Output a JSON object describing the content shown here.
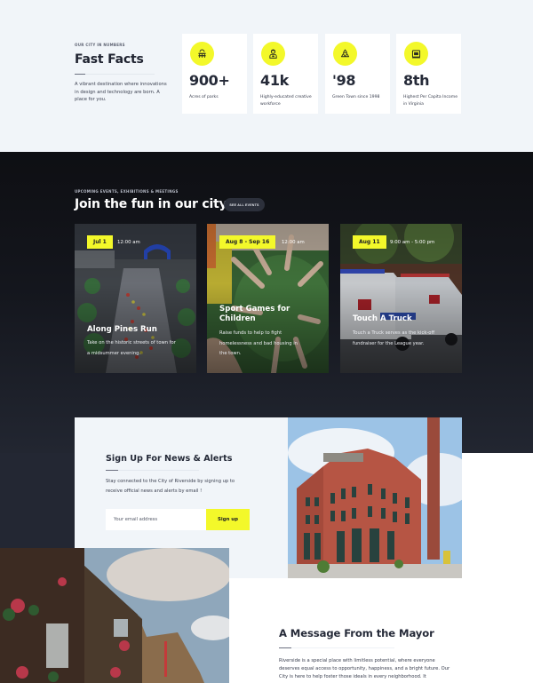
{
  "facts": {
    "eyebrow": "OUR CITY IN NUMBERS",
    "title": "Fast Facts",
    "description": "A vibrant destination where innovations in design and technology are born. A place for you.",
    "cards": [
      {
        "icon": "park-bench-icon",
        "value": "900+",
        "label": "Acres of parks"
      },
      {
        "icon": "worker-icon",
        "value": "41k",
        "label": "Highly-educated creative workforce"
      },
      {
        "icon": "recycle-icon",
        "value": "'98",
        "label": "Green Town since 1998"
      },
      {
        "icon": "money-icon",
        "value": "8th",
        "label": "Highest Per Capita Income in Virginia"
      }
    ]
  },
  "events": {
    "eyebrow": "UPCOMING EVENTS, EXHIBITIONS & MEETINGS",
    "title": "Join the fun in our city!",
    "see_all_label": "SEE ALL EVENTS",
    "items": [
      {
        "date": "Jul 1",
        "time": "12:00 am",
        "title": "Along Pines Run",
        "description": "Take on the historic streets of town for a midsummer evening."
      },
      {
        "date": "Aug 8 - Sep 16",
        "time": "12:00 am",
        "title": "Sport Games for Children",
        "description": "Raise funds to help to fight homelessness and bad housing in the town."
      },
      {
        "date": "Aug 11",
        "time": "9:00 am - 5:00 pm",
        "title": "Touch A Truck",
        "description": "Touch a Truck serves as the kick-off fundraiser for the League year."
      }
    ]
  },
  "signup": {
    "title": "Sign Up For News & Alerts",
    "description": "Stay connected to the City of Riverside by signing up to receive official news and alerts by email !",
    "email_placeholder": "Your email address",
    "email_value": "",
    "button_label": "Sign up"
  },
  "mayor": {
    "title": "A Message From the Mayor",
    "text": "Riverside is a special place with limitless potential, where everyone deserves equal access to opportunity, happiness, and a bright future. Our City is here to help foster those ideals in every neighborhood. It"
  },
  "colors": {
    "accent": "#f3f82a",
    "dark_bg": "#14161d",
    "light_bg": "#f1f5f9",
    "heading": "#252a38"
  }
}
